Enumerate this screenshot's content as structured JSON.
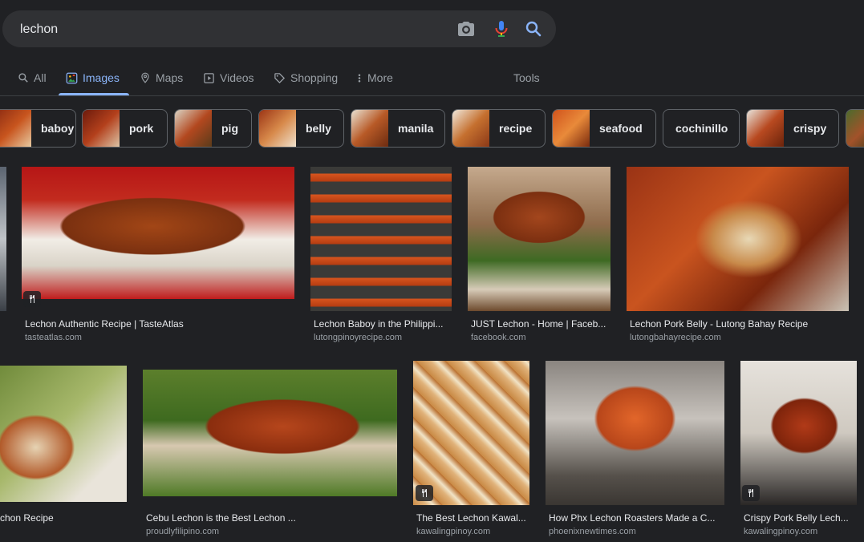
{
  "search": {
    "query": "lechon"
  },
  "tabs": [
    {
      "label": "All",
      "active": false
    },
    {
      "label": "Images",
      "active": true
    },
    {
      "label": "Maps",
      "active": false
    },
    {
      "label": "Videos",
      "active": false
    },
    {
      "label": "Shopping",
      "active": false
    },
    {
      "label": "More",
      "active": false
    }
  ],
  "tools_label": "Tools",
  "chips": [
    "baboy",
    "pork",
    "pig",
    "belly",
    "manila",
    "recipe",
    "seafood",
    "cochinillo",
    "crispy"
  ],
  "results": [
    {
      "caption": "Lechon Authentic Recipe | TasteAtlas",
      "source": "tasteatlas.com",
      "recipe_badge": true
    },
    {
      "caption": "Lechon Baboy in the Philippi...",
      "source": "lutongpinoyrecipe.com",
      "recipe_badge": false
    },
    {
      "caption": "JUST Lechon - Home | Faceb...",
      "source": "facebook.com",
      "recipe_badge": false
    },
    {
      "caption": "Lechon Pork Belly - Lutong Bahay Recipe",
      "source": "lutongbahayrecipe.com",
      "recipe_badge": false
    },
    {
      "caption": "chon Recipe",
      "source": "",
      "recipe_badge": false
    },
    {
      "caption": "Cebu Lechon is the Best Lechon ...",
      "source": "proudlyfilipino.com",
      "recipe_badge": false
    },
    {
      "caption": "The Best Lechon Kawal...",
      "source": "kawalingpinoy.com",
      "recipe_badge": true
    },
    {
      "caption": "How Phx Lechon Roasters Made a C...",
      "source": "phoenixnewtimes.com",
      "recipe_badge": false
    },
    {
      "caption": "Crispy Pork Belly Lech...",
      "source": "kawalingpinoy.com",
      "recipe_badge": true
    }
  ],
  "colors": {
    "background": "#202124",
    "accent": "#8ab4f8",
    "text": "#e8eaed",
    "muted": "#9aa0a6",
    "chip_border": "#5f6368"
  }
}
